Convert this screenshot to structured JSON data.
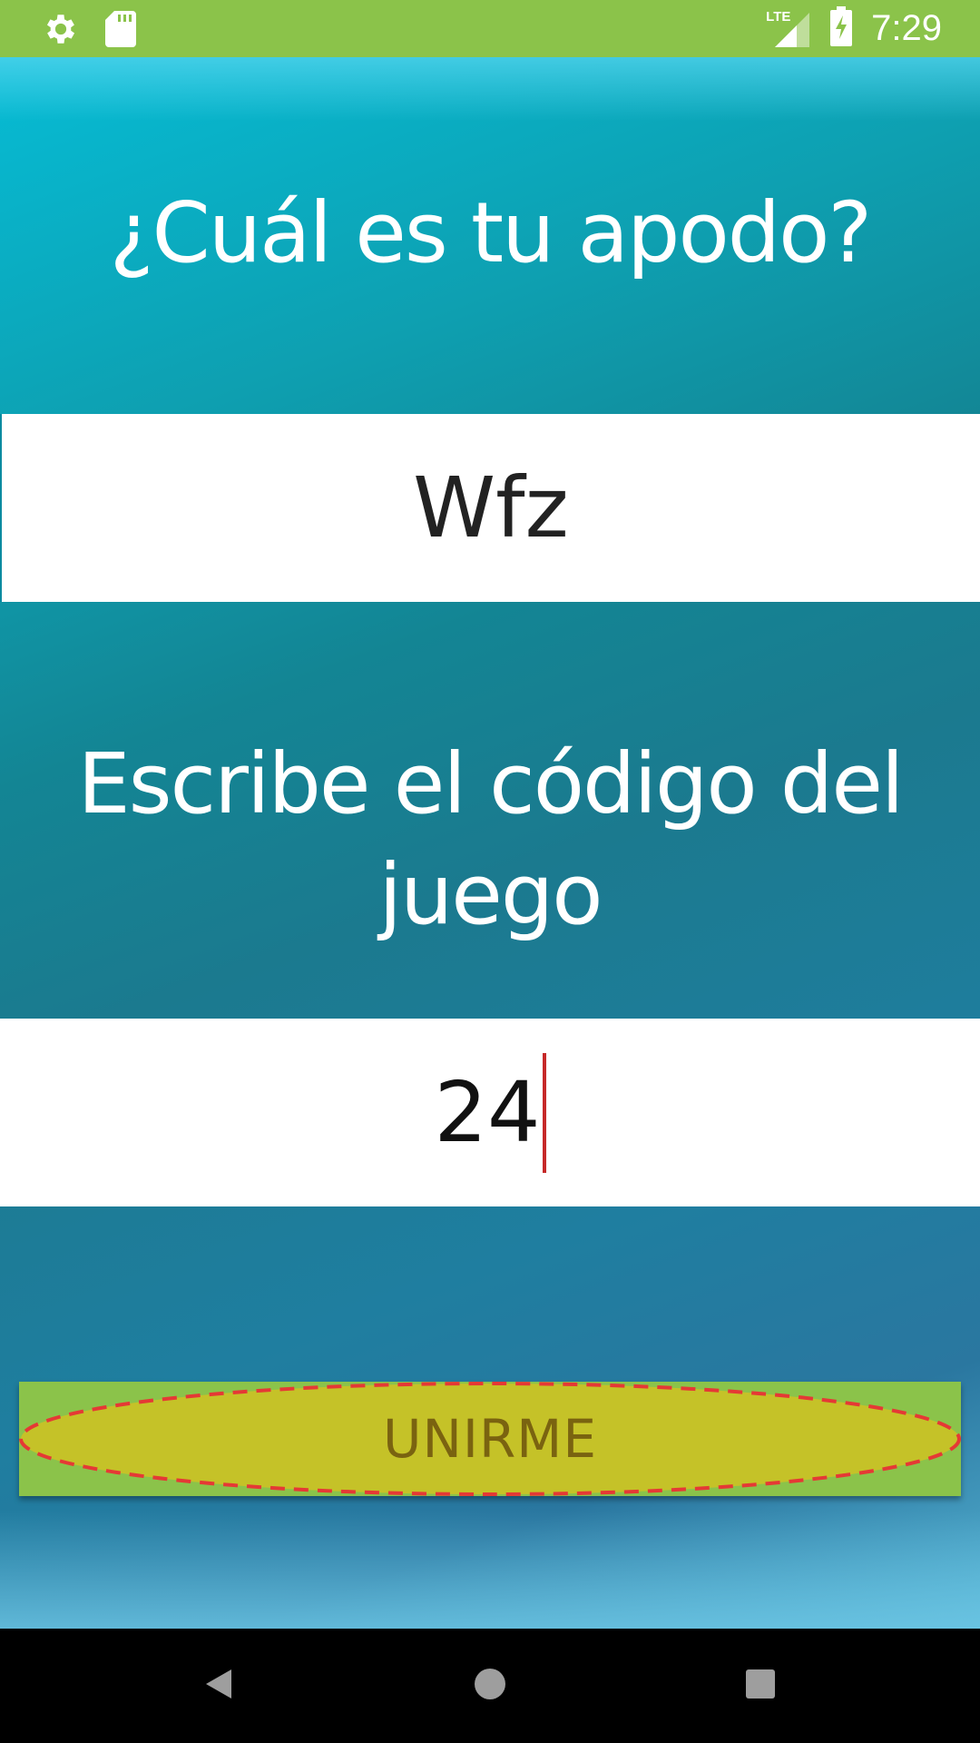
{
  "status_bar": {
    "left_icons": [
      "gear-icon",
      "sd-card-icon"
    ],
    "network_label": "LTE",
    "right_icons": [
      "lte-signal-icon",
      "battery-charging-icon"
    ],
    "time": "7:29",
    "background_color": "#8bc34a"
  },
  "form": {
    "nickname_prompt": "¿Cuál es tu apodo?",
    "nickname_value": "Wfz",
    "code_prompt": "Escribe el código del juego",
    "code_value": "24",
    "join_label": "UNIRME"
  },
  "colors": {
    "button_bg": "#8bc34a",
    "button_highlight": "#c5c228",
    "button_text": "#7a6310",
    "caret": "#c62828",
    "dashed_outline": "#e53935"
  },
  "nav_bar": {
    "buttons": [
      "back-icon",
      "home-icon",
      "recents-icon"
    ]
  }
}
